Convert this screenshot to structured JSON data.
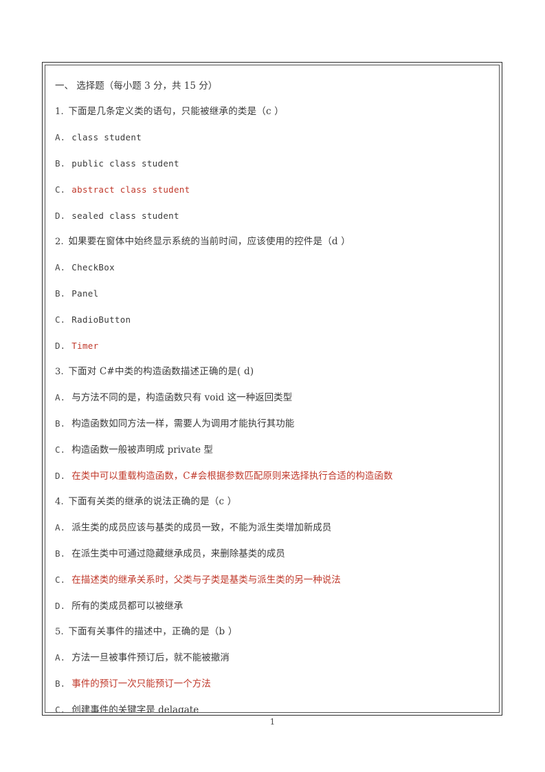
{
  "document": {
    "heading": "一、 选择题（每小题 3 分，共 15 分）",
    "footer_page_number": "1",
    "answer_color": "#c0392b",
    "text_color": "#3a3a3a"
  },
  "questions": [
    {
      "number": "1.",
      "stem": "下面是几条定义类的语句，只能被继承的类是（c ）",
      "options": [
        {
          "label": "A.",
          "text": "class student",
          "is_answer": false,
          "script": "latin"
        },
        {
          "label": "B.",
          "text": "public class student",
          "is_answer": false,
          "script": "latin"
        },
        {
          "label": "C.",
          "text": "abstract class student",
          "is_answer": true,
          "script": "latin"
        },
        {
          "label": "D.",
          "text": "sealed class student",
          "is_answer": false,
          "script": "latin"
        }
      ]
    },
    {
      "number": "2.",
      "stem": "如果要在窗体中始终显示系统的当前时间，应该使用的控件是（d ）",
      "options": [
        {
          "label": "A.",
          "text": "CheckBox",
          "is_answer": false,
          "script": "latin"
        },
        {
          "label": "B.",
          "text": "Panel",
          "is_answer": false,
          "script": "latin"
        },
        {
          "label": "C.",
          "text": "RadioButton",
          "is_answer": false,
          "script": "latin"
        },
        {
          "label": "D.",
          "text": "Timer",
          "is_answer": true,
          "script": "latin"
        }
      ]
    },
    {
      "number": "3.",
      "stem": "下面对 C#中类的构造函数描述正确的是( d)",
      "options": [
        {
          "label": "A.",
          "text": "与方法不同的是，构造函数只有 void 这一种返回类型",
          "is_answer": false,
          "script": "cjk"
        },
        {
          "label": "B.",
          "text": "构造函数如同方法一样，需要人为调用才能执行其功能",
          "is_answer": false,
          "script": "cjk"
        },
        {
          "label": "C.",
          "text": "构造函数一般被声明成 private 型",
          "is_answer": false,
          "script": "cjk"
        },
        {
          "label": "D.",
          "text": "在类中可以重载构造函数，C#会根据参数匹配原则来选择执行合适的构造函数",
          "is_answer": true,
          "script": "cjk"
        }
      ]
    },
    {
      "number": "4.",
      "stem": "下面有关类的继承的说法正确的是（c ）",
      "options": [
        {
          "label": "A.",
          "text": "派生类的成员应该与基类的成员一致，不能为派生类增加新成员",
          "is_answer": false,
          "script": "cjk"
        },
        {
          "label": "B.",
          "text": "在派生类中可通过隐藏继承成员，来删除基类的成员",
          "is_answer": false,
          "script": "cjk"
        },
        {
          "label": "C.",
          "text": "在描述类的继承关系时，父类与子类是基类与派生类的另一种说法",
          "is_answer": true,
          "script": "cjk"
        },
        {
          "label": "D.",
          "text": "所有的类成员都可以被继承",
          "is_answer": false,
          "script": "cjk"
        }
      ]
    },
    {
      "number": "5.",
      "stem": "下面有关事件的描述中，正确的是（b ）",
      "options": [
        {
          "label": "A.",
          "text": "方法一旦被事件预订后，就不能被撤消",
          "is_answer": false,
          "script": "cjk"
        },
        {
          "label": "B.",
          "text": "事件的预订一次只能预订一个方法",
          "is_answer": true,
          "script": "cjk"
        },
        {
          "label": "C.",
          "text": "创建事件的关键字是 delagate",
          "is_answer": false,
          "script": "cjk"
        }
      ]
    }
  ]
}
